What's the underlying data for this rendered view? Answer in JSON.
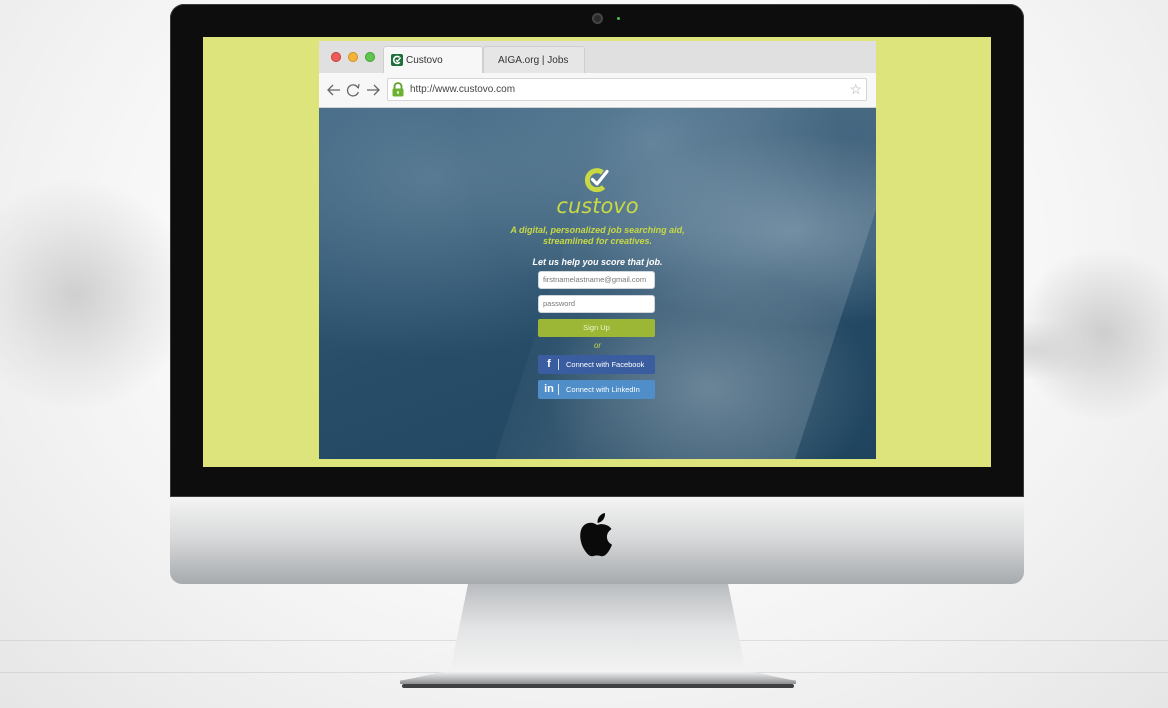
{
  "browser": {
    "tabs": [
      {
        "label": "Custovo",
        "active": true
      },
      {
        "label": "AIGA.org | Jobs",
        "active": false
      }
    ],
    "url": "http://www.custovo.com"
  },
  "page": {
    "brand_name": "custovo",
    "tagline_line1": "A digital, personalized job searching aid,",
    "tagline_line2": "streamlined for creatives.",
    "headline": "Let us help you score that job.",
    "email_placeholder": "firstnamelastname@gmail.com",
    "password_placeholder": "password",
    "signup_label": "Sign Up",
    "or_text": "or",
    "facebook_label": "Connect with Facebook",
    "linkedin_label": "Connect with LinkedIn"
  },
  "icons": {
    "back": "back-arrow-icon",
    "reload": "reload-icon",
    "forward": "forward-arrow-icon",
    "lock": "lock-icon",
    "bookmark": "star-icon",
    "facebook": "facebook-icon",
    "linkedin": "linkedin-icon",
    "apple": "apple-logo-icon"
  },
  "colors": {
    "screen_background": "#dde47c",
    "brand_green": "#c8d944",
    "signup_green": "#9cb736",
    "facebook_blue": "#3a5da0",
    "linkedin_blue": "#4f8ec9"
  }
}
